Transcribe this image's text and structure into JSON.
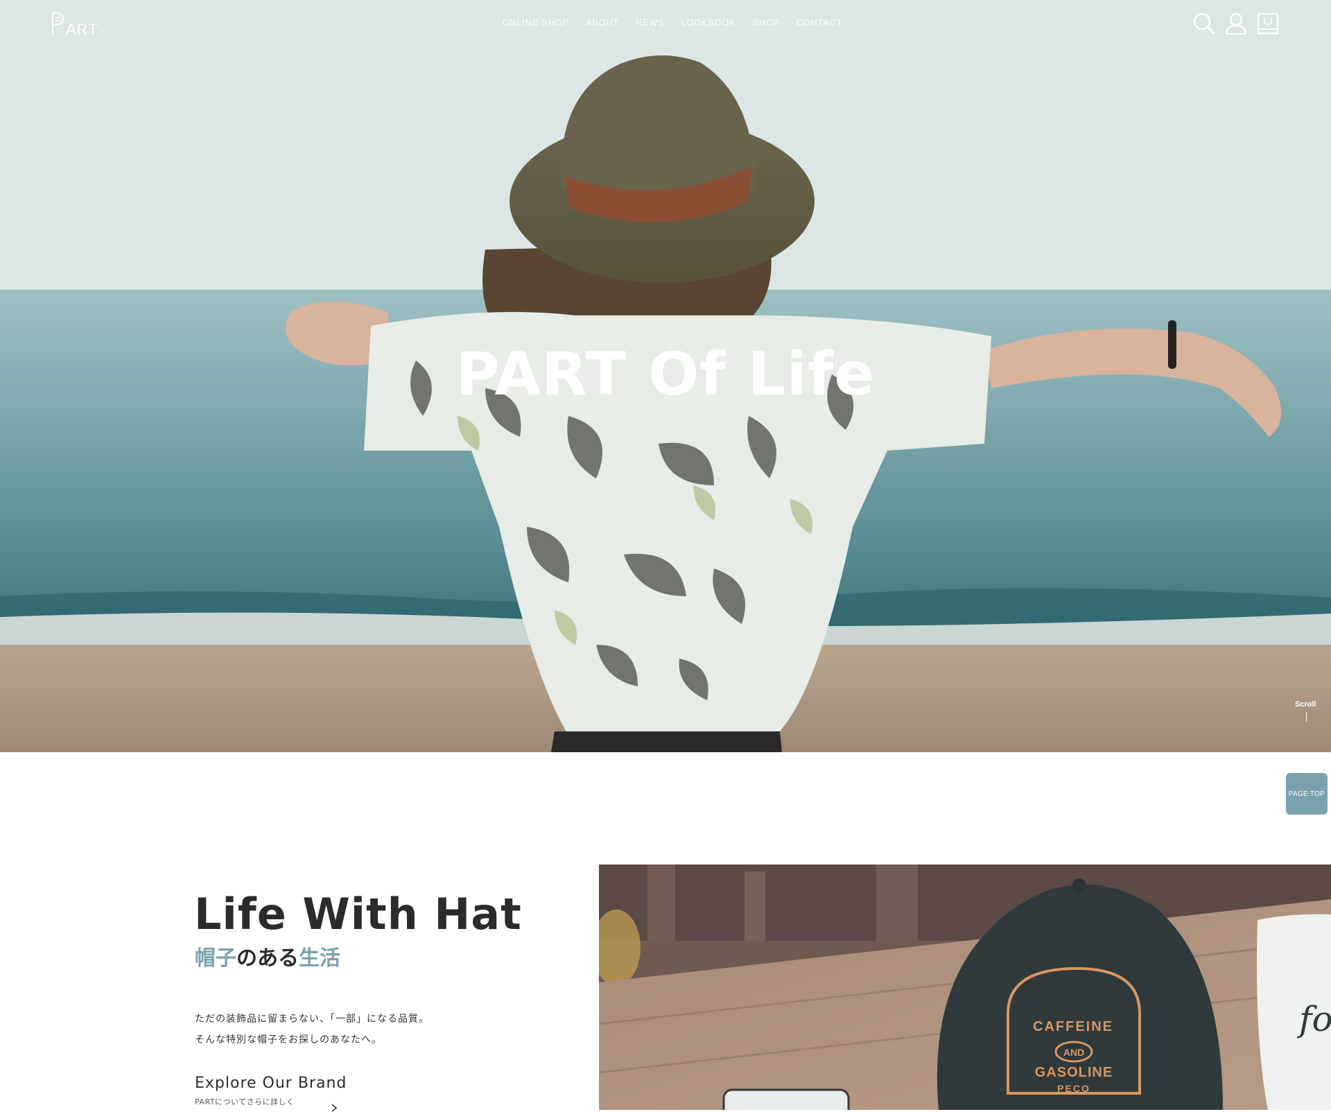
{
  "header": {
    "nav": [
      "ONLINE SHOP",
      "ABOUT",
      "NEWS",
      "LOOKBOOK",
      "SHOP",
      "CONTACT"
    ],
    "icons": [
      "search-icon",
      "account-icon",
      "cart-icon"
    ]
  },
  "hero": {
    "title": "PART Of Life",
    "scroll_label": "Scroll"
  },
  "page_top": "PAGE TOP",
  "brand": {
    "title": "Life With Hat",
    "subtitle_parts": [
      "帽子",
      "のある",
      "生活"
    ],
    "description_lines": [
      "ただの装飾品に留まらない、「一部」になる品質。",
      "そんな特別な帽子をお探しのあなたへ。"
    ],
    "explore_title": "Explore Our Brand",
    "explore_sub": "PARTについてさらに詳しく"
  },
  "colors": {
    "accent": "#7aa2ad",
    "text_dark": "#2b2b2b"
  }
}
